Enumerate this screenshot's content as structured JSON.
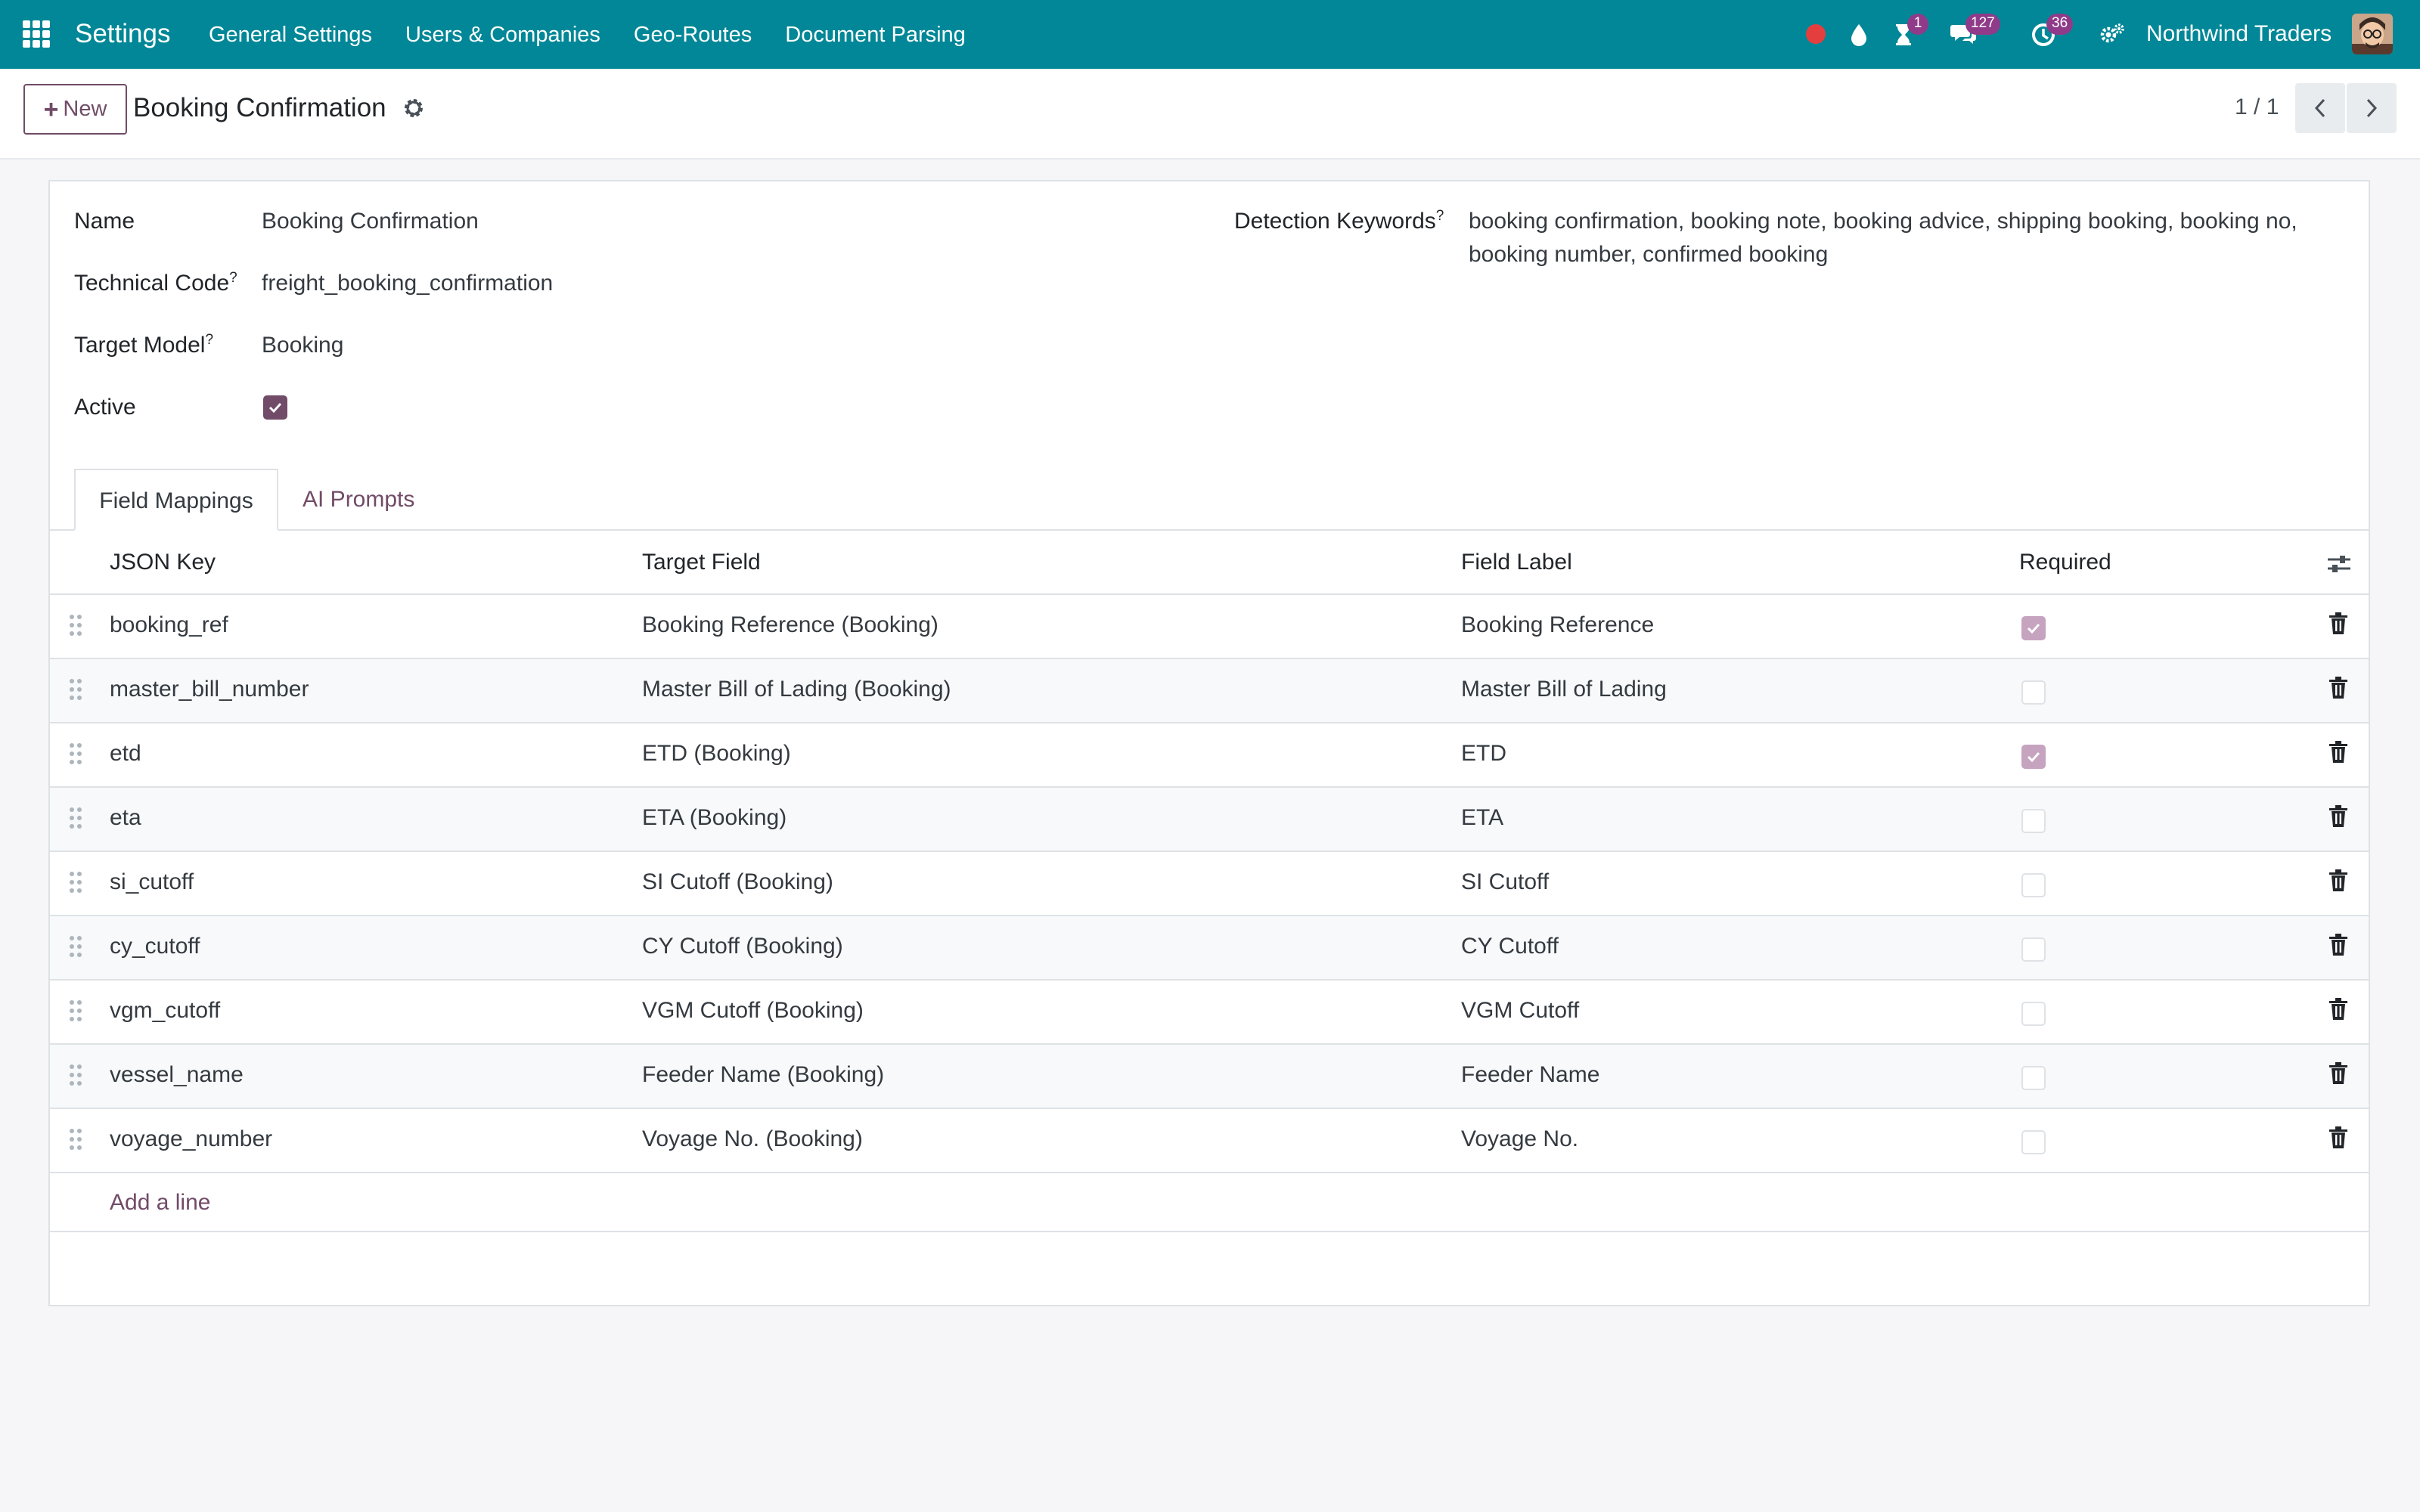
{
  "navbar": {
    "app_name": "Settings",
    "menu": [
      "General Settings",
      "Users & Companies",
      "Geo-Routes",
      "Document Parsing"
    ],
    "badges": {
      "activity": "1",
      "messages": "127",
      "clock": "36"
    },
    "company": "Northwind Traders",
    "colors": {
      "bar": "#018797",
      "badge": "#8f3b8a",
      "recording_dot": "#e53e3e"
    }
  },
  "control_panel": {
    "new_label": "New",
    "record_title": "Booking Confirmation",
    "pager": "1 / 1"
  },
  "form": {
    "name_label": "Name",
    "name_value": "Booking Confirmation",
    "technical_code_label": "Technical Code",
    "technical_code_value": "freight_booking_confirmation",
    "target_model_label": "Target Model",
    "target_model_value": "Booking",
    "active_label": "Active",
    "active": true,
    "help_mark": "?",
    "keywords_label": "Detection Keywords",
    "keywords_value": "booking confirmation, booking note, booking advice, shipping booking, booking no, booking number, confirmed booking"
  },
  "tabs": [
    "Field Mappings",
    "AI Prompts"
  ],
  "table": {
    "headers": [
      "JSON Key",
      "Target Field",
      "Field Label",
      "Required"
    ],
    "rows": [
      {
        "key": "booking_ref",
        "target": "Booking Reference (Booking)",
        "label": "Booking Reference",
        "required": true
      },
      {
        "key": "master_bill_number",
        "target": "Master Bill of Lading (Booking)",
        "label": "Master Bill of Lading",
        "required": false
      },
      {
        "key": "etd",
        "target": "ETD (Booking)",
        "label": "ETD",
        "required": true
      },
      {
        "key": "eta",
        "target": "ETA (Booking)",
        "label": "ETA",
        "required": false
      },
      {
        "key": "si_cutoff",
        "target": "SI Cutoff (Booking)",
        "label": "SI Cutoff",
        "required": false
      },
      {
        "key": "cy_cutoff",
        "target": "CY Cutoff (Booking)",
        "label": "CY Cutoff",
        "required": false
      },
      {
        "key": "vgm_cutoff",
        "target": "VGM Cutoff (Booking)",
        "label": "VGM Cutoff",
        "required": false
      },
      {
        "key": "vessel_name",
        "target": "Feeder Name (Booking)",
        "label": "Feeder Name",
        "required": false
      },
      {
        "key": "voyage_number",
        "target": "Voyage No. (Booking)",
        "label": "Voyage No.",
        "required": false
      }
    ],
    "add_line": "Add a line"
  },
  "colors": {
    "accent": "#714b67",
    "accent_muted": "#c6a3bf"
  }
}
